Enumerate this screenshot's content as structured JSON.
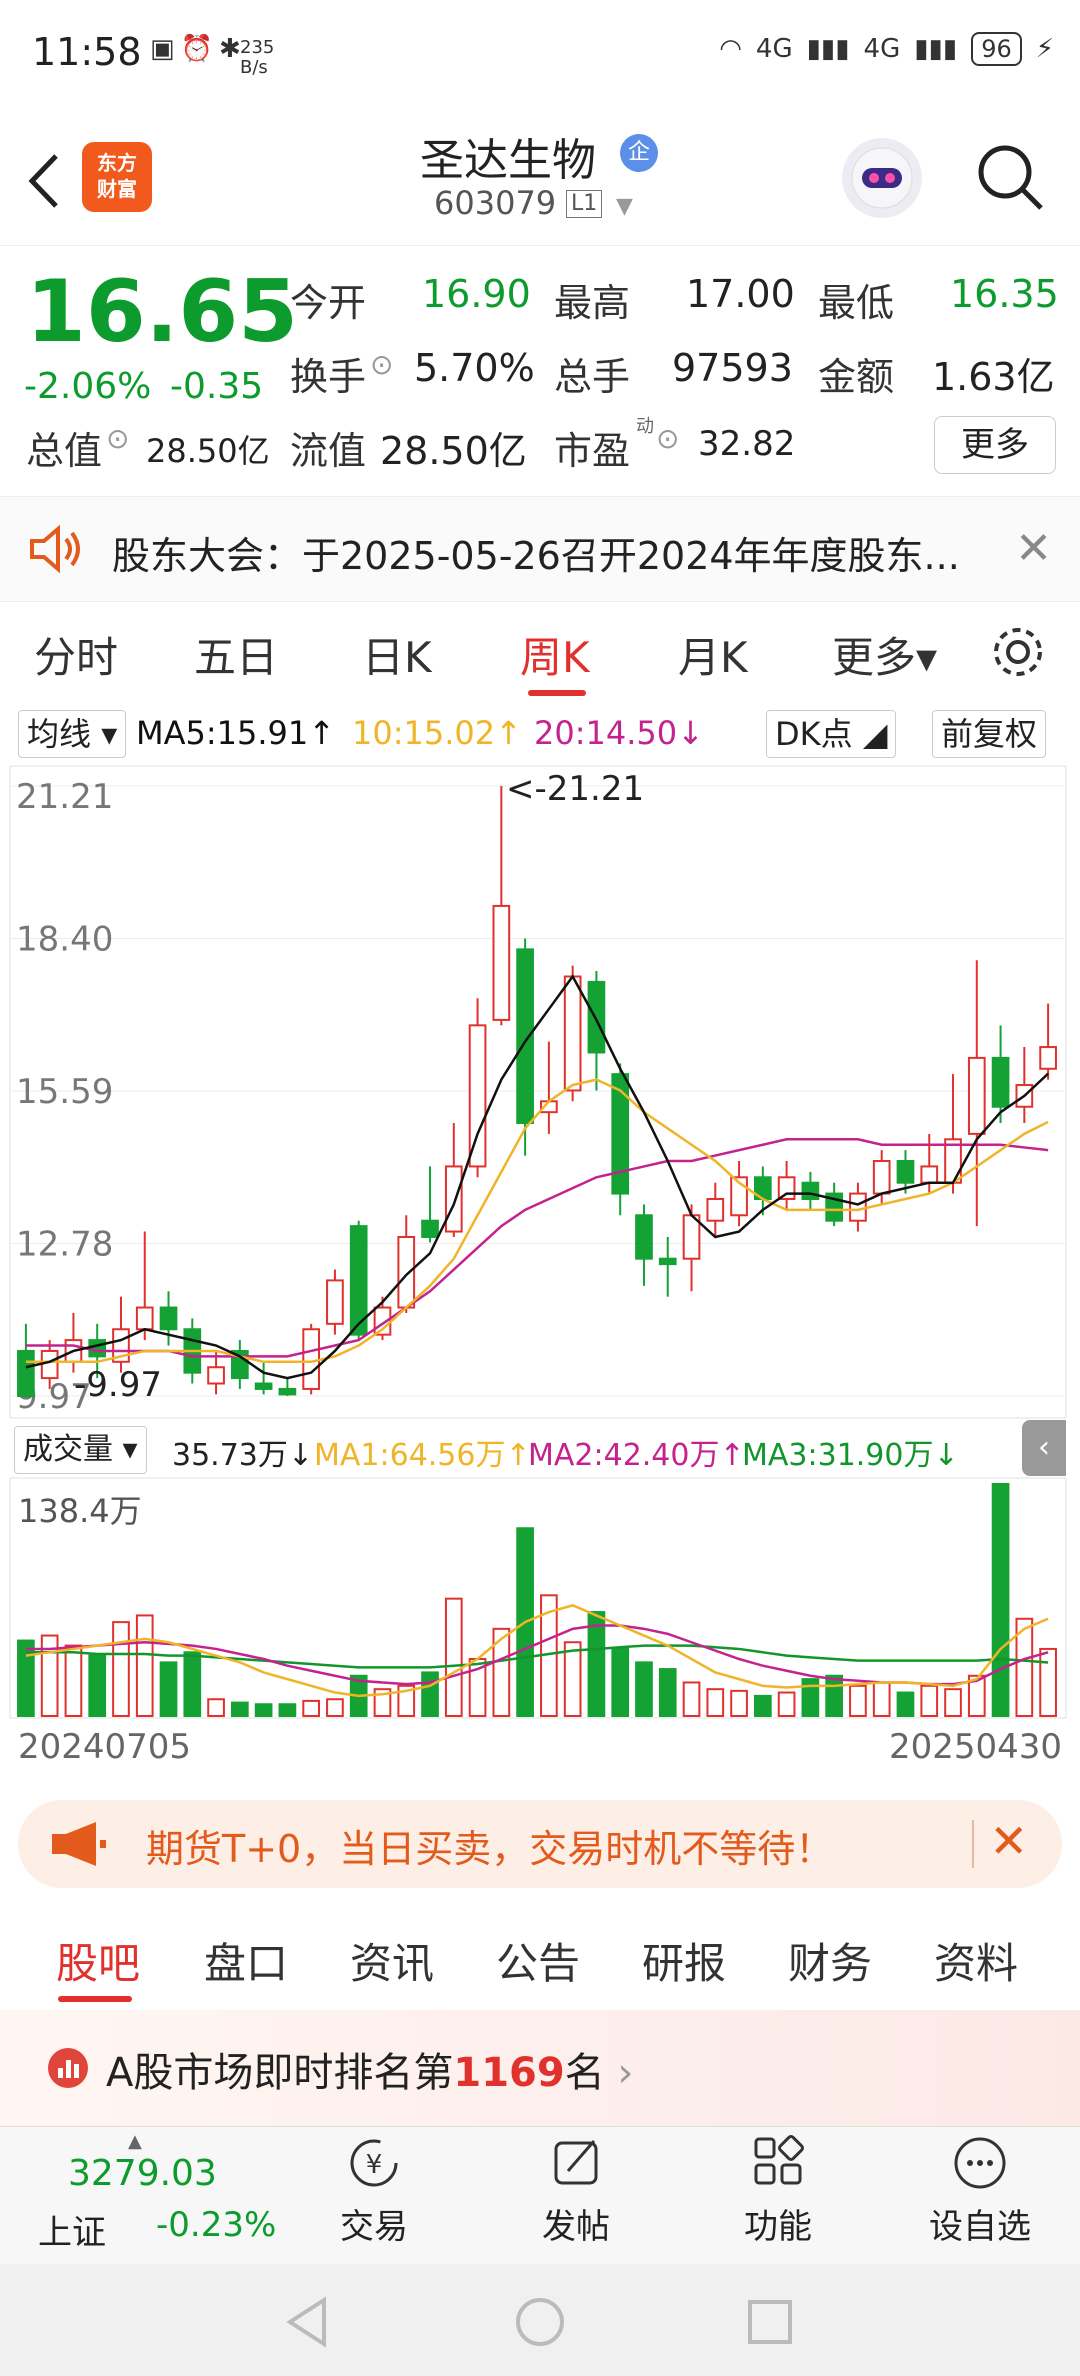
{
  "status": {
    "time": "11:58",
    "speed": "235\nB/s",
    "signal_4g_1": "4G",
    "signal_4g_2": "4G",
    "battery": "96"
  },
  "header": {
    "app_logo": "东方\n财富",
    "stock_name": "圣达生物",
    "badge": "企",
    "stock_code": "603079",
    "level": "L1"
  },
  "quote": {
    "price": "16.65",
    "change_pct": "-2.06%",
    "change": "-0.35",
    "open_label": "今开",
    "open": "16.90",
    "high_label": "最高",
    "high": "17.00",
    "low_label": "最低",
    "low": "16.35",
    "turnover_label": "换手",
    "turnover": "5.70%",
    "volume_label": "总手",
    "volume": "97593",
    "amount_label": "金额",
    "amount": "1.63亿",
    "mktcap_label": "总值",
    "mktcap": "28.50亿",
    "float_label": "流值",
    "float_cap": "28.50亿",
    "pe_label": "市盈",
    "pe_sup": "动",
    "pe": "32.82",
    "more": "更多"
  },
  "notice": {
    "text": "股东大会：于2025-05-26召开2024年年度股东..."
  },
  "period_tabs": [
    "分时",
    "五日",
    "日K",
    "周K",
    "月K",
    "更多▾"
  ],
  "active_period": 3,
  "kline_legend": {
    "ma_select": "均线",
    "ma5": "MA5:15.91↑",
    "ma10": "10:15.02↑",
    "ma20": "20:14.50↓",
    "dk": "DK点",
    "adjust": "前复权"
  },
  "kline_axis": {
    "y_labels": [
      "21.21",
      "18.40",
      "15.59",
      "12.78",
      "9.97"
    ],
    "max_label": "<-21.21",
    "min_label": "-9.97"
  },
  "vol_legend": {
    "select": "成交量",
    "vol": "35.73万↓",
    "ma1": "MA1:64.56万↑",
    "ma2": "MA2:42.40万↑",
    "ma3": "MA3:31.90万↓"
  },
  "vol_axis": {
    "max_label": "138.4万",
    "start_date": "20240705",
    "end_date": "20250430"
  },
  "chart_data": {
    "type": "candlestick",
    "ylim": [
      9.97,
      21.21
    ],
    "candles": [
      {
        "o": 10.8,
        "c": 9.97,
        "h": 11.3,
        "l": 9.97
      },
      {
        "o": 10.3,
        "c": 10.8,
        "h": 11.0,
        "l": 10.1
      },
      {
        "o": 10.6,
        "c": 11.0,
        "h": 11.5,
        "l": 10.4
      },
      {
        "o": 11.0,
        "c": 10.7,
        "h": 11.3,
        "l": 10.3
      },
      {
        "o": 10.6,
        "c": 11.2,
        "h": 11.8,
        "l": 10.4
      },
      {
        "o": 11.2,
        "c": 11.6,
        "h": 13.0,
        "l": 11.0
      },
      {
        "o": 11.6,
        "c": 11.2,
        "h": 11.9,
        "l": 10.9
      },
      {
        "o": 11.2,
        "c": 10.4,
        "h": 11.4,
        "l": 10.2
      },
      {
        "o": 10.2,
        "c": 10.5,
        "h": 10.8,
        "l": 10.0
      },
      {
        "o": 10.8,
        "c": 10.3,
        "h": 11.0,
        "l": 10.1
      },
      {
        "o": 10.2,
        "c": 10.1,
        "h": 10.6,
        "l": 10.0
      },
      {
        "o": 10.1,
        "c": 10.0,
        "h": 10.3,
        "l": 9.97
      },
      {
        "o": 10.1,
        "c": 11.2,
        "h": 11.3,
        "l": 10.0
      },
      {
        "o": 11.3,
        "c": 12.1,
        "h": 12.3,
        "l": 11.1
      },
      {
        "o": 13.1,
        "c": 11.1,
        "h": 13.2,
        "l": 11.0
      },
      {
        "o": 11.1,
        "c": 11.6,
        "h": 11.8,
        "l": 11.0
      },
      {
        "o": 11.6,
        "c": 12.9,
        "h": 13.3,
        "l": 11.5
      },
      {
        "o": 13.2,
        "c": 12.9,
        "h": 14.2,
        "l": 12.8
      },
      {
        "o": 13.0,
        "c": 14.2,
        "h": 15.0,
        "l": 12.9
      },
      {
        "o": 14.2,
        "c": 16.8,
        "h": 17.3,
        "l": 14.0
      },
      {
        "o": 16.9,
        "c": 19.0,
        "h": 21.21,
        "l": 16.8
      },
      {
        "o": 18.2,
        "c": 15.0,
        "h": 18.4,
        "l": 14.4
      },
      {
        "o": 15.2,
        "c": 15.4,
        "h": 16.5,
        "l": 14.8
      },
      {
        "o": 15.6,
        "c": 17.7,
        "h": 17.9,
        "l": 15.4
      },
      {
        "o": 17.6,
        "c": 16.3,
        "h": 17.8,
        "l": 15.6
      },
      {
        "o": 15.9,
        "c": 13.7,
        "h": 16.1,
        "l": 13.3
      },
      {
        "o": 13.3,
        "c": 12.5,
        "h": 13.5,
        "l": 12.0
      },
      {
        "o": 12.5,
        "c": 12.4,
        "h": 12.9,
        "l": 11.8
      },
      {
        "o": 12.5,
        "c": 13.3,
        "h": 13.5,
        "l": 11.9
      },
      {
        "o": 13.2,
        "c": 13.6,
        "h": 13.9,
        "l": 12.9
      },
      {
        "o": 13.3,
        "c": 14.0,
        "h": 14.3,
        "l": 13.1
      },
      {
        "o": 14.0,
        "c": 13.6,
        "h": 14.2,
        "l": 13.3
      },
      {
        "o": 13.6,
        "c": 14.0,
        "h": 14.3,
        "l": 13.4
      },
      {
        "o": 13.9,
        "c": 13.6,
        "h": 14.1,
        "l": 13.4
      },
      {
        "o": 13.7,
        "c": 13.2,
        "h": 13.9,
        "l": 13.1
      },
      {
        "o": 13.2,
        "c": 13.7,
        "h": 13.9,
        "l": 13.0
      },
      {
        "o": 13.7,
        "c": 14.3,
        "h": 14.5,
        "l": 13.5
      },
      {
        "o": 14.3,
        "c": 13.9,
        "h": 14.5,
        "l": 13.7
      },
      {
        "o": 13.9,
        "c": 14.2,
        "h": 14.8,
        "l": 13.7
      },
      {
        "o": 13.9,
        "c": 14.7,
        "h": 15.9,
        "l": 13.7
      },
      {
        "o": 14.8,
        "c": 16.2,
        "h": 18.0,
        "l": 13.1
      },
      {
        "o": 16.2,
        "c": 15.3,
        "h": 16.8,
        "l": 15.0
      },
      {
        "o": 15.3,
        "c": 15.7,
        "h": 16.4,
        "l": 15.0
      },
      {
        "o": 16.0,
        "c": 16.4,
        "h": 17.2,
        "l": 15.8
      }
    ],
    "ma5": [
      10.5,
      10.6,
      10.8,
      10.9,
      11.0,
      11.2,
      11.1,
      11.0,
      10.9,
      10.7,
      10.4,
      10.3,
      10.4,
      10.8,
      11.3,
      11.7,
      12.2,
      12.6,
      13.5,
      14.8,
      15.8,
      16.5,
      17.1,
      17.7,
      16.9,
      16.0,
      15.2,
      14.3,
      13.3,
      12.9,
      13.0,
      13.4,
      13.7,
      13.7,
      13.6,
      13.5,
      13.7,
      13.8,
      13.9,
      13.9,
      14.7,
      15.2,
      15.5,
      15.91
    ],
    "ma10": [
      10.6,
      10.6,
      10.6,
      10.6,
      10.7,
      10.8,
      10.8,
      10.8,
      10.8,
      10.7,
      10.6,
      10.6,
      10.6,
      10.7,
      10.9,
      11.2,
      11.6,
      12.0,
      12.5,
      13.3,
      14.1,
      14.9,
      15.4,
      15.7,
      15.8,
      15.6,
      15.2,
      14.9,
      14.6,
      14.3,
      13.9,
      13.6,
      13.4,
      13.4,
      13.4,
      13.4,
      13.5,
      13.6,
      13.7,
      13.9,
      14.2,
      14.5,
      14.8,
      15.02
    ],
    "ma20": [
      10.9,
      10.9,
      10.9,
      10.8,
      10.8,
      10.8,
      10.8,
      10.7,
      10.7,
      10.7,
      10.7,
      10.7,
      10.8,
      10.9,
      11.0,
      11.3,
      11.6,
      11.9,
      12.3,
      12.7,
      13.1,
      13.4,
      13.6,
      13.8,
      14.0,
      14.1,
      14.2,
      14.3,
      14.3,
      14.4,
      14.5,
      14.6,
      14.7,
      14.7,
      14.7,
      14.7,
      14.6,
      14.6,
      14.6,
      14.6,
      14.6,
      14.6,
      14.55,
      14.5
    ],
    "volume": {
      "ylim": [
        0,
        138.4
      ],
      "values": [
        45,
        48,
        42,
        36,
        56,
        60,
        32,
        38,
        10,
        8,
        7,
        7,
        9,
        10,
        24,
        16,
        18,
        26,
        70,
        34,
        52,
        112,
        72,
        44,
        62,
        40,
        32,
        28,
        20,
        16,
        15,
        12,
        14,
        22,
        24,
        18,
        20,
        14,
        18,
        16,
        24,
        138.4,
        58,
        40
      ],
      "ma1": [
        36,
        38,
        40,
        42,
        44,
        46,
        44,
        40,
        36,
        32,
        26,
        22,
        18,
        14,
        12,
        13,
        15,
        18,
        26,
        34,
        46,
        56,
        62,
        66,
        60,
        54,
        48,
        42,
        34,
        26,
        22,
        18,
        17,
        18,
        18,
        19,
        20,
        20,
        19,
        18,
        22,
        40,
        52,
        58
      ],
      "ma2": [
        40,
        40,
        41,
        42,
        43,
        44,
        43,
        42,
        40,
        37,
        34,
        30,
        27,
        24,
        21,
        20,
        19,
        20,
        24,
        28,
        34,
        40,
        46,
        52,
        54,
        54,
        52,
        49,
        44,
        39,
        34,
        30,
        27,
        24,
        22,
        21,
        20,
        20,
        19,
        19,
        21,
        28,
        34,
        38
      ],
      "ma3": [
        38,
        38,
        38,
        37,
        37,
        37,
        36,
        36,
        35,
        34,
        33,
        32,
        31,
        30,
        29,
        29,
        29,
        29,
        30,
        31,
        33,
        35,
        37,
        39,
        40,
        41,
        42,
        42,
        42,
        41,
        40,
        38,
        36,
        35,
        34,
        33,
        33,
        33,
        33,
        33,
        33,
        34,
        33,
        31.9
      ]
    },
    "colors": {
      "up": "#e0312d",
      "down": "#14a235",
      "ma5": "#111111",
      "ma10": "#f0b429",
      "ma20": "#c4238e",
      "vol_ma3": "#12962c"
    }
  },
  "promo": {
    "text": "期货T+0，当日买卖，交易时机不等待！"
  },
  "bottom_tabs": [
    "股吧",
    "盘口",
    "资讯",
    "公告",
    "研报",
    "财务",
    "资料"
  ],
  "ranking": {
    "prefix": "A股市场即时排名第",
    "rank": "1169",
    "suffix": "名"
  },
  "bottom_nav": {
    "index_value": "3279.03",
    "index_name": "上证",
    "index_pct": "-0.23%",
    "items": [
      "交易",
      "发帖",
      "功能",
      "设自选"
    ]
  }
}
